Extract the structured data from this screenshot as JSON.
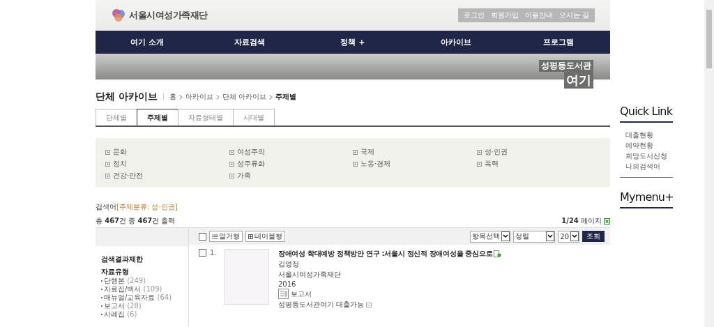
{
  "header": {
    "logo_text": "서울시여성가족재단",
    "top_links": [
      "로그인",
      "회원가입",
      "이용안내",
      "오시는 길"
    ],
    "nav": [
      "여기 소개",
      "자료검색",
      "정책 +",
      "아카이브",
      "프로그램"
    ],
    "library_name": "성평등도서관",
    "library_sub": "여기"
  },
  "archive": {
    "title": "단체 아카이브",
    "breadcrumb": [
      "홈",
      "아카이브",
      "단체 아카이브",
      "주제별"
    ],
    "tabs": [
      {
        "label": "단체별",
        "selected": false
      },
      {
        "label": "주제별",
        "selected": true
      },
      {
        "label": "자료형태별",
        "selected": false
      },
      {
        "label": "시대별",
        "selected": false
      }
    ],
    "topics": [
      "문화",
      "여성주의",
      "국제",
      "성·인권",
      "정치",
      "성주류화",
      "노동·경제",
      "폭력",
      "건강·안전",
      "가족"
    ]
  },
  "search": {
    "label": "검색어",
    "term": "[주제분류: 성·인권]",
    "count_prefix": "총 ",
    "total": "467",
    "count_mid": "건 중 ",
    "shown": "467",
    "count_suffix": "건 출력",
    "page": "1/24",
    "page_suffix": " 페이지"
  },
  "toolbar": {
    "select_all_checked": false,
    "list_view": "열거형",
    "table_view": "테이블형",
    "selects": [
      "항목선택",
      "정렬",
      "20"
    ],
    "submit": "조회"
  },
  "filter": {
    "title": "검색결과제한",
    "group": "자료유형",
    "items": [
      {
        "label": "단행본",
        "count": "(249)"
      },
      {
        "label": "자료집/백서",
        "count": "(109)"
      },
      {
        "label": "매뉴얼/교육자료",
        "count": "(64)"
      },
      {
        "label": "보고서",
        "count": "(28)"
      },
      {
        "label": "사례집",
        "count": "(6)"
      }
    ]
  },
  "results": [
    {
      "checked": false,
      "number": "1.",
      "title": "장애여성 학대예방 정책방안 연구 :서울시 정신적 장애여성을 중심으로",
      "author": "김영정",
      "publisher": "서울시여성가족재단",
      "year": "2016",
      "type": "보고서",
      "availability": "성평등도서관여기 대출가능"
    }
  ],
  "quick_link": {
    "title": "Quick Link",
    "items": [
      "대출현황",
      "예약현황",
      "희망도서신청",
      "나의검색어"
    ],
    "mymenu": "Mymenu+"
  }
}
